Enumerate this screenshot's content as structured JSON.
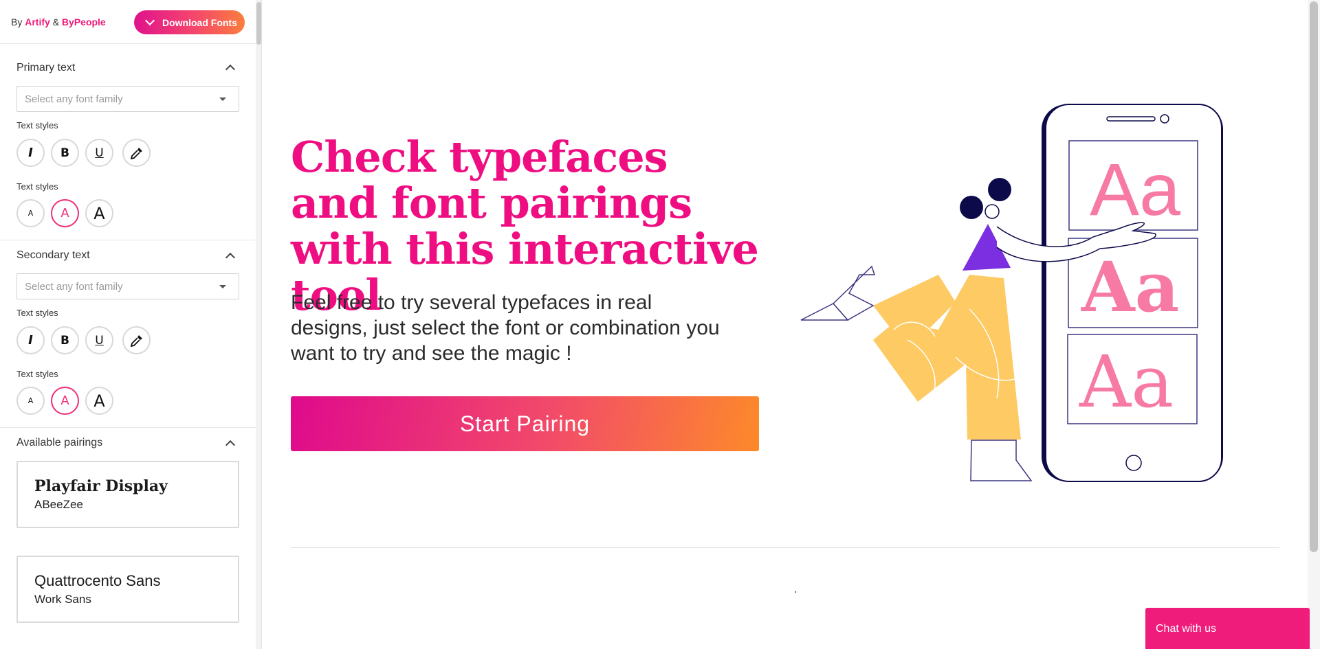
{
  "sidebar": {
    "byline": {
      "prefix": "By",
      "artify": "Artify",
      "amp": "&",
      "bypeople": "ByPeople"
    },
    "download_button": "Download Fonts",
    "primary": {
      "title": "Primary text",
      "select_placeholder": "Select any font family",
      "styles_label": "Text styles",
      "sizes_label": "Text styles",
      "style_buttons": [
        "I",
        "B",
        "U"
      ],
      "size_buttons": [
        "A",
        "A",
        "A"
      ]
    },
    "secondary": {
      "title": "Secondary text",
      "select_placeholder": "Select any font family",
      "styles_label": "Text styles",
      "sizes_label": "Text styles",
      "style_buttons": [
        "I",
        "B",
        "U"
      ],
      "size_buttons": [
        "A",
        "A",
        "A"
      ]
    },
    "pairings": {
      "title": "Available pairings",
      "items": [
        {
          "primary": "Playfair Display",
          "secondary": "ABeeZee"
        },
        {
          "primary": "Quattrocento Sans",
          "secondary": "Work Sans"
        }
      ]
    }
  },
  "main": {
    "headline": "Check typefaces and font pairings with this interactive tool",
    "subline": "Feel free to try several typefaces in real designs, just select the font or combination you want to try and see the magic !",
    "start_button": "Start Pairing",
    "illustration": {
      "glyphs": [
        "Aa",
        "Aa",
        "Aa"
      ]
    }
  },
  "chat": {
    "label": "Chat with us"
  },
  "colors": {
    "accent": "#ef1a7a",
    "gradient_start": "#df0a8c",
    "gradient_end": "#fd8a2a",
    "figure_yellow": "#fdca63",
    "navy": "#0d0a4a",
    "violet": "#7b2fe0",
    "glyph_pink": "#f77aa4"
  }
}
